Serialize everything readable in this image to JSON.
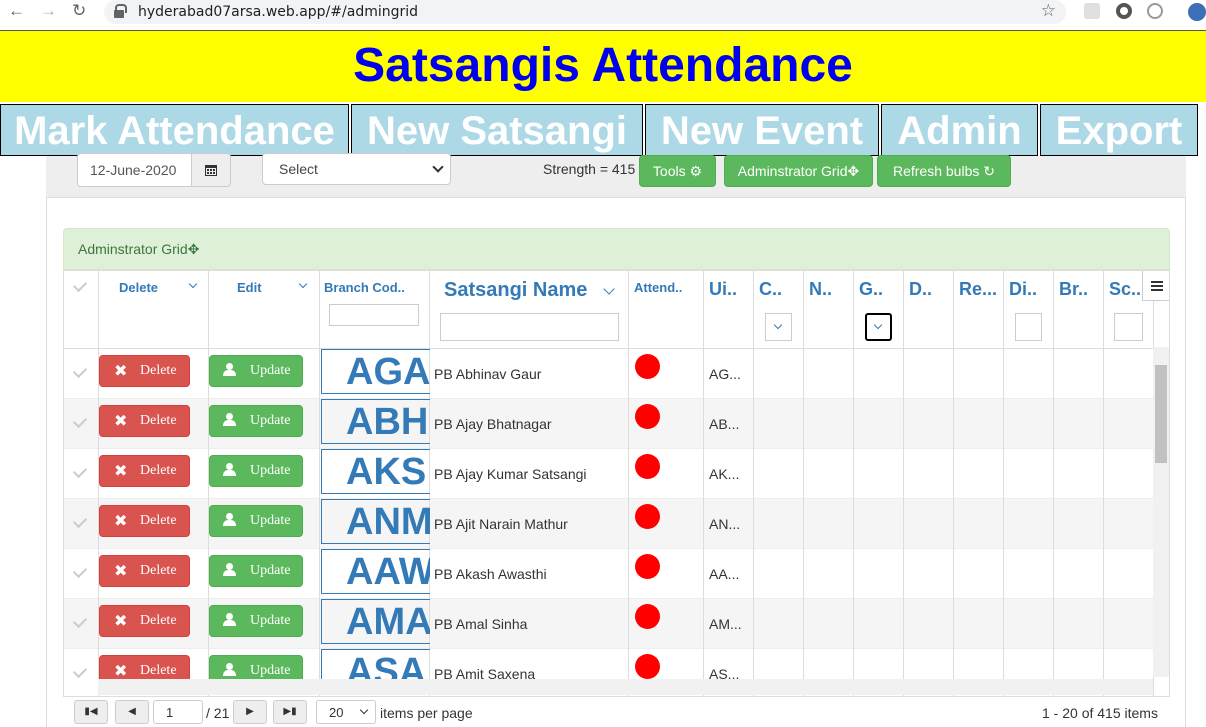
{
  "browser": {
    "url": "hyderabad07arsa.web.app/#/admingrid"
  },
  "banner": {
    "title": "Satsangis Attendance"
  },
  "nav": [
    "Mark Attendance",
    "New Satsangi",
    "New Event",
    "Admin",
    "Export"
  ],
  "toolbar": {
    "date": "12-June-2020",
    "select": "Select",
    "strength": "Strength = 415",
    "tools": "Tools",
    "admin_grid": "Adminstrator Grid",
    "refresh": "Refresh bulbs"
  },
  "grid": {
    "title": "Adminstrator Grid",
    "headers": {
      "delete": "Delete",
      "edit": "Edit",
      "branch": "Branch Cod..",
      "name": "Satsangi Name",
      "attend": "Attend..",
      "uid": "Ui..",
      "c": "C..",
      "n": "N..",
      "g": "G..",
      "d": "D..",
      "re": "Re...",
      "di": "Di..",
      "br": "Br..",
      "sc": "Sc..."
    },
    "delete_label": "Delete",
    "update_label": "Update",
    "attend_color": "#ff0000",
    "rows": [
      {
        "branch": "AGA",
        "name": "PB Abhinav Gaur",
        "uid": "AG..."
      },
      {
        "branch": "ABH",
        "name": "PB Ajay Bhatnagar",
        "uid": "AB..."
      },
      {
        "branch": "AKS",
        "name": "PB Ajay Kumar Satsangi",
        "uid": "AK..."
      },
      {
        "branch": "ANM",
        "name": "PB Ajit Narain Mathur",
        "uid": "AN..."
      },
      {
        "branch": "AAW",
        "name": "PB Akash Awasthi",
        "uid": "AA..."
      },
      {
        "branch": "AMA",
        "name": "PB Amal Sinha",
        "uid": "AM..."
      },
      {
        "branch": "ASA",
        "name": "PB Amit Saxena",
        "uid": "AS..."
      }
    ]
  },
  "pager": {
    "page": "1",
    "of_pages": "/ 21",
    "page_size": "20",
    "per_page_label": "items per page",
    "summary": "1 - 20 of 415 items"
  },
  "colors": {
    "banner_bg": "#ffff00",
    "banner_text": "#0000ee",
    "nav_bg": "#add8e6",
    "danger": "#d9534f",
    "success": "#5cb85c",
    "link": "#337ab7"
  }
}
